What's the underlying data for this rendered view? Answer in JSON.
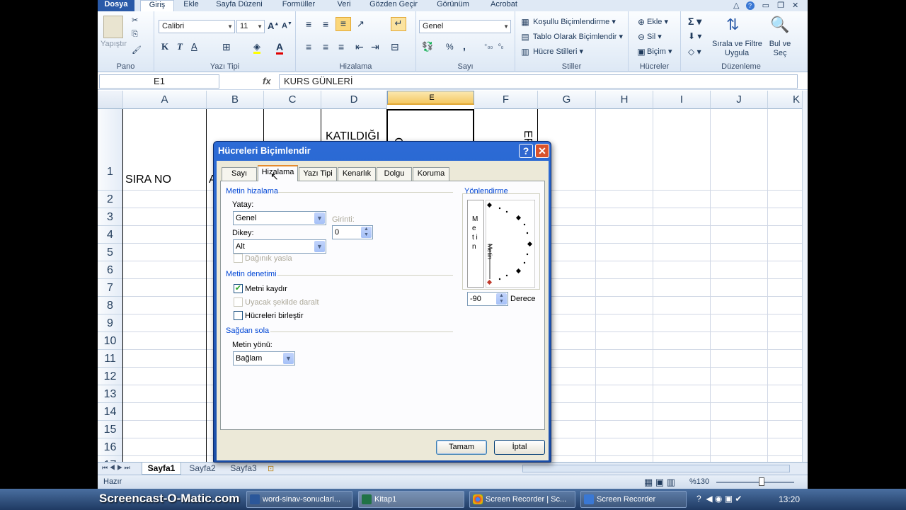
{
  "menu": {
    "tabs": [
      "Dosya",
      "Giriş",
      "Ekle",
      "Sayfa Düzeni",
      "Formüller",
      "Veri",
      "Gözden Geçir",
      "Görünüm",
      "Acrobat"
    ]
  },
  "ribbon": {
    "groups": {
      "pano": "Pano",
      "yazi_tipi": "Yazı Tipi",
      "hizalama": "Hizalama",
      "sayi": "Sayı",
      "stiller": "Stiller",
      "hucreler": "Hücreler",
      "duzenleme": "Düzenleme"
    },
    "paste_label": "Yapıştır",
    "font_name": "Calibri",
    "font_size": "11",
    "number_format": "Genel",
    "bold": "K",
    "italic": "T",
    "underline": "A",
    "percent": "%",
    "comma": ",",
    "styles": {
      "cond": "Koşullu Biçimlendirme",
      "table": "Tablo Olarak Biçimlendir",
      "cell": "Hücre Stilleri"
    },
    "cells": {
      "insert": "Ekle",
      "delete": "Sil",
      "format": "Biçim"
    },
    "editing": {
      "sort_line1": "Sırala ve Filtre",
      "sort_line2": "Uygula",
      "find_line1": "Bul ve",
      "find_line2": "Seç"
    }
  },
  "formula_bar": {
    "name_box": "E1",
    "fx": "fx",
    "content": "KURS GÜNLERİ"
  },
  "grid": {
    "columns": [
      "A",
      "B",
      "C",
      "D",
      "E",
      "F",
      "G",
      "H",
      "I",
      "J",
      "K"
    ],
    "selected_column": "E",
    "rows": [
      "1",
      "2",
      "3",
      "4",
      "5",
      "6",
      "7",
      "8",
      "9",
      "10",
      "11",
      "12",
      "13",
      "14",
      "15",
      "16",
      "17"
    ],
    "cells": {
      "A1": "SIRA NO",
      "B1": "ADI",
      "D1": "KATILDIĞI",
      "E1": "G",
      "F1": "ERİ"
    }
  },
  "sheets": {
    "tabs": [
      "Sayfa1",
      "Sayfa2",
      "Sayfa3"
    ],
    "active": "Sayfa1"
  },
  "status": {
    "ready": "Hazır",
    "zoom": "%130"
  },
  "dialog": {
    "title": "Hücreleri Biçimlendir",
    "help": "?",
    "close": "✕",
    "tabs": [
      "Sayı",
      "Hizalama",
      "Yazı Tipi",
      "Kenarlık",
      "Dolgu",
      "Koruma"
    ],
    "active_tab": "Hizalama",
    "text_alignment": {
      "section": "Metin hizalama",
      "horizontal_label": "Yatay:",
      "horizontal_value": "Genel",
      "vertical_label": "Dikey:",
      "vertical_value": "Alt",
      "indent_label": "Girinti:",
      "indent_value": "0",
      "distributed_label": "Dağınık yasla"
    },
    "text_control": {
      "section": "Metin denetimi",
      "wrap_label": "Metni kaydır",
      "wrap_checked": true,
      "shrink_label": "Uyacak şekilde daralt",
      "merge_label": "Hücreleri birleştir"
    },
    "rtl": {
      "section": "Sağdan sola",
      "direction_label": "Metin yönü:",
      "direction_value": "Bağlam"
    },
    "orientation": {
      "section": "Yönlendirme",
      "vertical_text": "M e t i n",
      "dial_text": "Metin",
      "degrees_value": "-90",
      "degrees_label": "Derece"
    },
    "ok": "Tamam",
    "cancel": "İptal"
  },
  "taskbar": {
    "watermark": "Screencast-O-Matic.com",
    "items": [
      "word-sinav-sonuclari...",
      "Kitap1",
      "Screen Recorder | Sc...",
      "Screen Recorder"
    ],
    "clock": "13:20"
  }
}
